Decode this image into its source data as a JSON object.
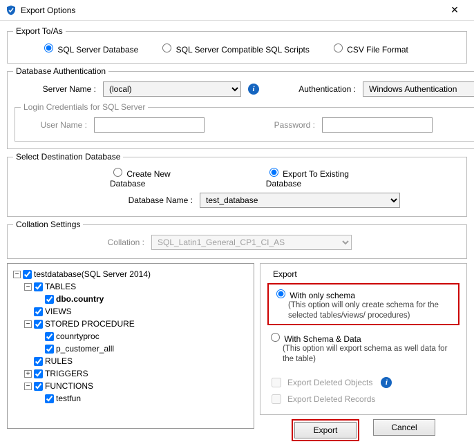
{
  "window": {
    "title": "Export Options"
  },
  "exportToAs": {
    "legend": "Export To/As",
    "opt1": "SQL Server Database",
    "opt2": "SQL Server Compatible SQL Scripts",
    "opt3": "CSV File Format"
  },
  "dbAuth": {
    "legend": "Database Authentication",
    "serverNameLabel": "Server Name :",
    "serverNameValue": "(local)",
    "authLabel": "Authentication :",
    "authValue": "Windows Authentication",
    "loginLegend": "Login Credentials for SQL Server",
    "userNameLabel": "User Name :",
    "passwordLabel": "Password :"
  },
  "destDb": {
    "legend": "Select Destination Database",
    "opt1": "Create New Database",
    "opt2": "Export To Existing Database",
    "dbNameLabel": "Database Name :",
    "dbNameValue": "test_database"
  },
  "collation": {
    "legend": "Collation Settings",
    "label": "Collation :",
    "value": "SQL_Latin1_General_CP1_CI_AS"
  },
  "tree": {
    "root": "testdatabase(SQL Server 2014)",
    "tables": "TABLES",
    "table1": "dbo.country",
    "views": "VIEWS",
    "sp": "STORED PROCEDURE",
    "sp1": "counrtyproc",
    "sp2": "p_customer_alll",
    "rules": "RULES",
    "triggers": "TRIGGERS",
    "functions": "FUNCTIONS",
    "fn1": "testfun"
  },
  "exportOpts": {
    "legend": "Export",
    "schemaOnly": "With only schema",
    "schemaOnlyDesc": "(This option will only create schema for the  selected tables/views/ procedures)",
    "schemaData": "With Schema & Data",
    "schemaDataDesc": "(This option will export schema as well data for the table)",
    "delObjects": "Export Deleted Objects",
    "delRecords": "Export Deleted Records"
  },
  "buttons": {
    "export": "Export",
    "cancel": "Cancel"
  }
}
